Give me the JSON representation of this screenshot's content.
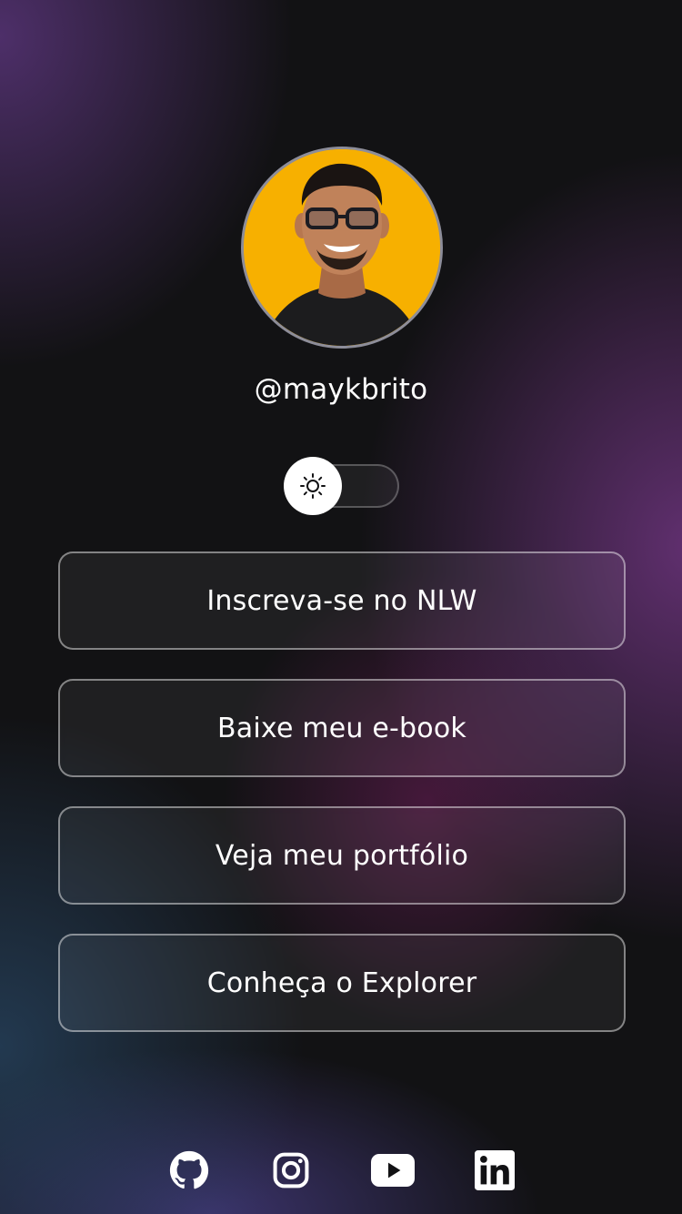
{
  "profile": {
    "username": "@maykbrito",
    "avatar_icon": "person-avatar"
  },
  "theme_switch": {
    "icon": "sun-icon",
    "state": "dark"
  },
  "links": [
    {
      "label": "Inscreva-se no NLW"
    },
    {
      "label": "Baixe meu e-book"
    },
    {
      "label": "Veja meu portfólio"
    },
    {
      "label": "Conheça o Explorer"
    }
  ],
  "social": [
    {
      "icon": "github-icon"
    },
    {
      "icon": "instagram-icon"
    },
    {
      "icon": "youtube-icon"
    },
    {
      "icon": "linkedin-icon"
    }
  ],
  "colors": {
    "background": "#121214",
    "avatar_bg": "#f7b000",
    "text": "#ffffff"
  }
}
